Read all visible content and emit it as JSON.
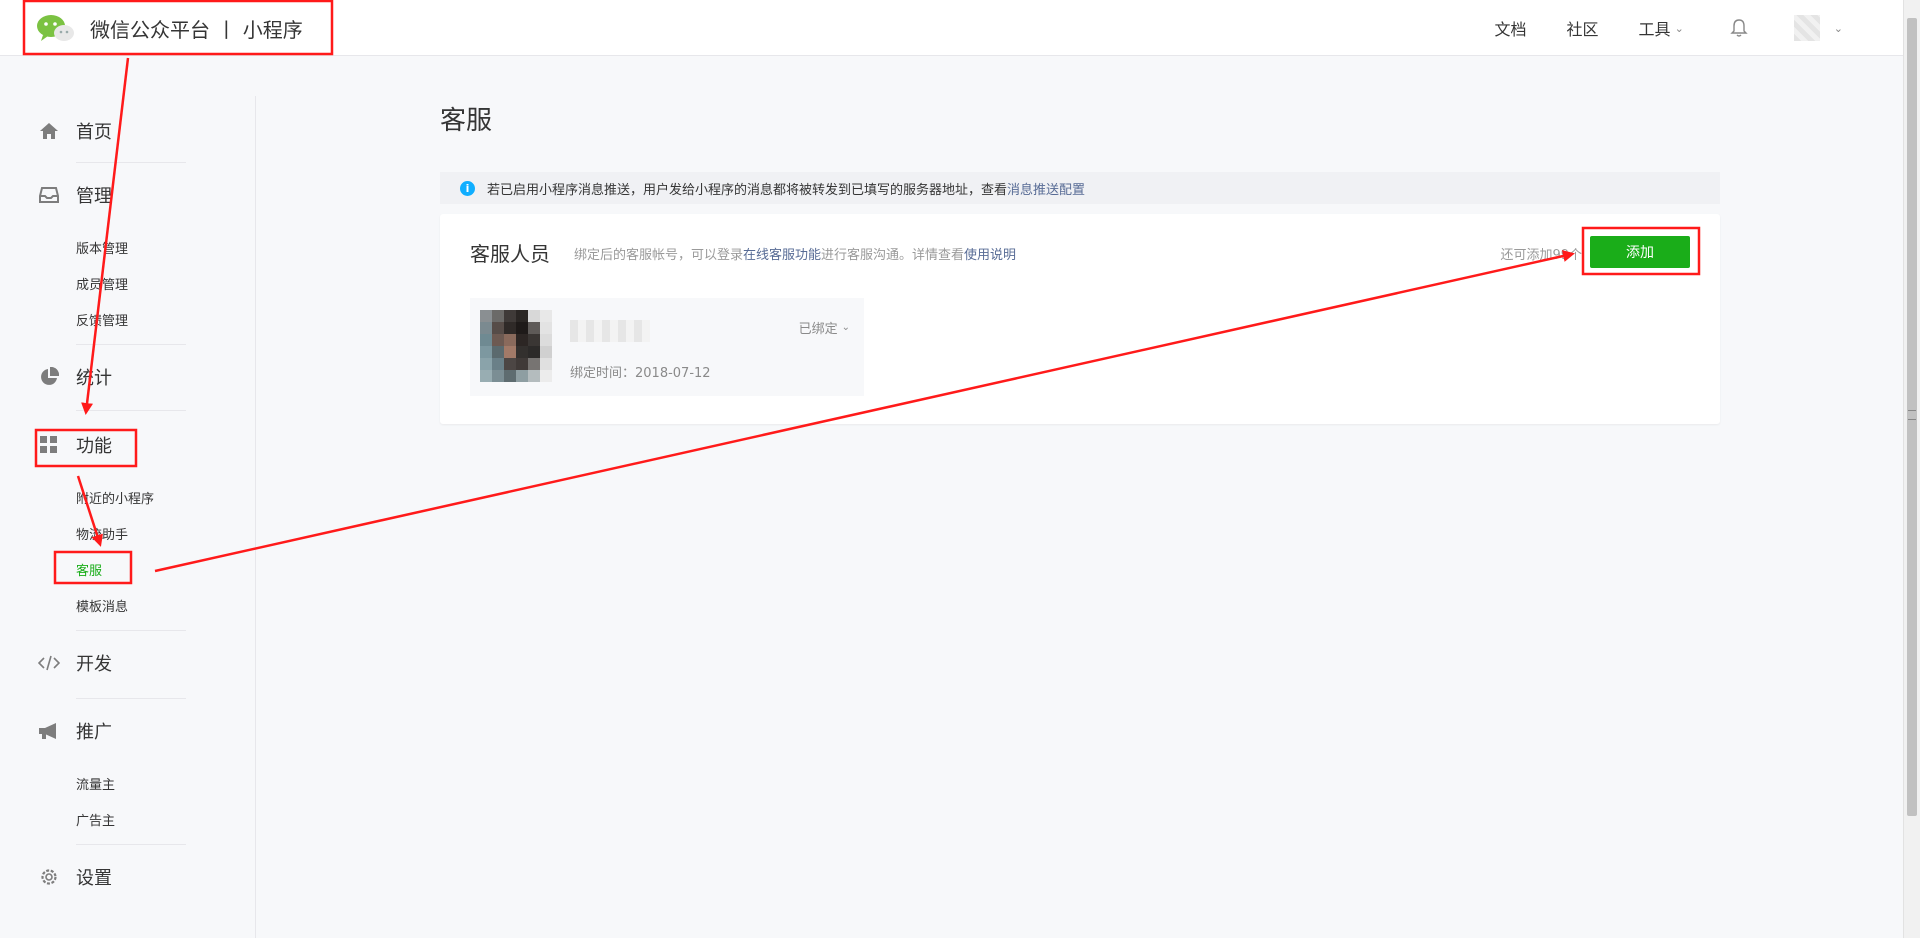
{
  "header": {
    "title": "微信公众平台 丨 小程序",
    "nav": [
      {
        "label": "文档"
      },
      {
        "label": "社区"
      },
      {
        "label": "工具"
      }
    ],
    "bell_icon": "bell-icon",
    "chevron_icon": "chevron-down-icon"
  },
  "sidebar": {
    "home": {
      "label": "首页",
      "icon": "home-icon"
    },
    "manage": {
      "label": "管理",
      "icon": "inbox-icon",
      "items": [
        "版本管理",
        "成员管理",
        "反馈管理"
      ]
    },
    "stats": {
      "label": "统计",
      "icon": "pie-chart-icon"
    },
    "features": {
      "label": "功能",
      "icon": "grid-icon",
      "items": [
        "附近的小程序",
        "物流助手",
        "客服",
        "模板消息"
      ],
      "active": "客服"
    },
    "develop": {
      "label": "开发",
      "icon": "code-icon"
    },
    "promote": {
      "label": "推广",
      "icon": "megaphone-icon",
      "items": [
        "流量主",
        "广告主"
      ]
    },
    "settings": {
      "label": "设置",
      "icon": "gear-icon"
    }
  },
  "main": {
    "title": "客服",
    "notice": {
      "text": "若已启用小程序消息推送，用户发给小程序的消息都将被转发到已填写的服务器地址，查看",
      "link": "消息推送配置"
    },
    "panel": {
      "title": "客服人员",
      "desc_prefix": "绑定后的客服帐号，可以登录",
      "desc_link1": "在线客服功能",
      "desc_mid": "进行客服沟通。详情查看",
      "desc_link2": "使用说明",
      "remain": "还可添加99个",
      "add_label": "添加"
    },
    "staff": {
      "status": "已绑定",
      "bind_time": "绑定时间：2018-07-12"
    }
  },
  "colors": {
    "accent": "#1aad19",
    "link": "#576b95",
    "annotation": "#ff1a1a",
    "info": "#10aeff"
  }
}
